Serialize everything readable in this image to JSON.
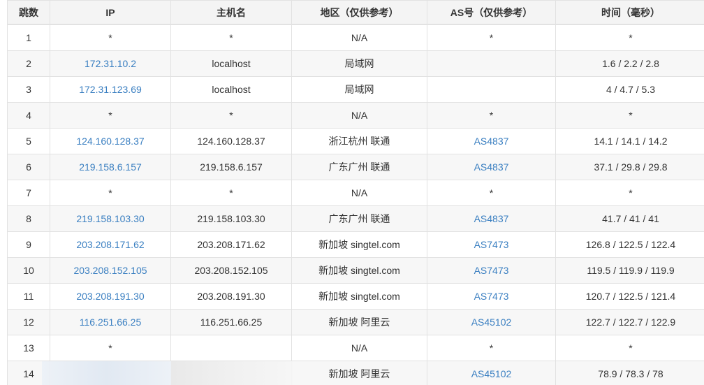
{
  "headers": {
    "hop": "跳数",
    "ip": "IP",
    "host": "主机名",
    "region": "地区（仅供参考）",
    "as": "AS号（仅供参考）",
    "time": "时间（毫秒）"
  },
  "rows": [
    {
      "hop": "1",
      "ip": "*",
      "host": "*",
      "region": "N/A",
      "as": "*",
      "time": "*"
    },
    {
      "hop": "2",
      "ip": "172.31.10.2",
      "host": "localhost",
      "region": "局域网",
      "as": "",
      "time": "1.6 / 2.2 / 2.8"
    },
    {
      "hop": "3",
      "ip": "172.31.123.69",
      "host": "localhost",
      "region": "局域网",
      "as": "",
      "time": "4 / 4.7 / 5.3"
    },
    {
      "hop": "4",
      "ip": "*",
      "host": "*",
      "region": "N/A",
      "as": "*",
      "time": "*"
    },
    {
      "hop": "5",
      "ip": "124.160.128.37",
      "host": "124.160.128.37",
      "region": "浙江杭州 联通",
      "as": "AS4837",
      "time": "14.1 / 14.1 / 14.2"
    },
    {
      "hop": "6",
      "ip": "219.158.6.157",
      "host": "219.158.6.157",
      "region": "广东广州 联通",
      "as": "AS4837",
      "time": "37.1 / 29.8 / 29.8"
    },
    {
      "hop": "7",
      "ip": "*",
      "host": "*",
      "region": "N/A",
      "as": "*",
      "time": "*"
    },
    {
      "hop": "8",
      "ip": "219.158.103.30",
      "host": "219.158.103.30",
      "region": "广东广州 联通",
      "as": "AS4837",
      "time": "41.7 / 41 / 41"
    },
    {
      "hop": "9",
      "ip": "203.208.171.62",
      "host": "203.208.171.62",
      "region": "新加坡 singtel.com",
      "as": "AS7473",
      "time": "126.8 / 122.5 / 122.4"
    },
    {
      "hop": "10",
      "ip": "203.208.152.105",
      "host": "203.208.152.105",
      "region": "新加坡 singtel.com",
      "as": "AS7473",
      "time": "119.5 / 119.9 / 119.9"
    },
    {
      "hop": "11",
      "ip": "203.208.191.30",
      "host": "203.208.191.30",
      "region": "新加坡 singtel.com",
      "as": "AS7473",
      "time": "120.7 / 122.5 / 121.4"
    },
    {
      "hop": "12",
      "ip": "116.251.66.25",
      "host": "116.251.66.25",
      "region": "新加坡 阿里云",
      "as": "AS45102",
      "time": "122.7 / 122.7 / 122.9"
    },
    {
      "hop": "13",
      "ip": "*",
      "host": "",
      "region": "N/A",
      "as": "*",
      "time": "*"
    },
    {
      "hop": "14",
      "ip": "",
      "host": "",
      "region": "新加坡 阿里云",
      "as": "AS45102",
      "time": "78.9 / 78.3 / 78"
    }
  ],
  "colors": {
    "link": "#3a7fc1",
    "header_bg": "#f4f4f4",
    "row_alt_bg": "#f7f7f7",
    "border": "#e2e2e2"
  }
}
